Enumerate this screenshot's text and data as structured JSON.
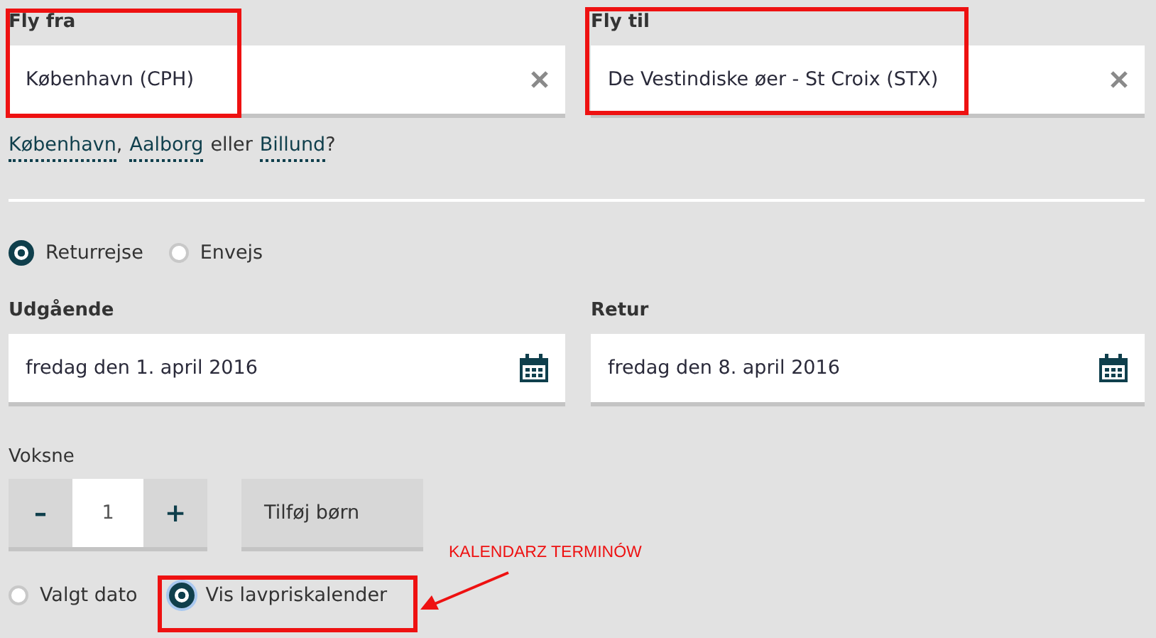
{
  "route": [
    {
      "label": "Fly fra",
      "value": "København (CPH)"
    },
    {
      "label": "Fly til",
      "value": "De Vestindiske øer - St Croix (STX)"
    }
  ],
  "suggestions": [
    {
      "kind": "link",
      "text": "København"
    },
    {
      "kind": "text",
      "text": ","
    },
    {
      "kind": "link",
      "text": "Aalborg"
    },
    {
      "kind": "text",
      "text": "eller"
    },
    {
      "kind": "link",
      "text": "Billund"
    },
    {
      "kind": "text",
      "text": "?"
    }
  ],
  "trip_type": [
    {
      "label": "Returrejse",
      "selected": true
    },
    {
      "label": "Envejs",
      "selected": false
    }
  ],
  "dates": [
    {
      "label": "Udgående",
      "value": "fredag den 1. april 2016"
    },
    {
      "label": "Retur",
      "value": "fredag den 8. april 2016"
    }
  ],
  "passengers": {
    "label": "Voksne",
    "minus": "–",
    "value": "1",
    "plus": "+",
    "add_children": "Tilføj børn"
  },
  "calendar_mode": [
    {
      "label": "Valgt dato",
      "selected": false
    },
    {
      "label": "Vis lavpriskalender",
      "selected": true
    }
  ],
  "annotation": {
    "text": "KALENDARZ TERMINÓW"
  }
}
